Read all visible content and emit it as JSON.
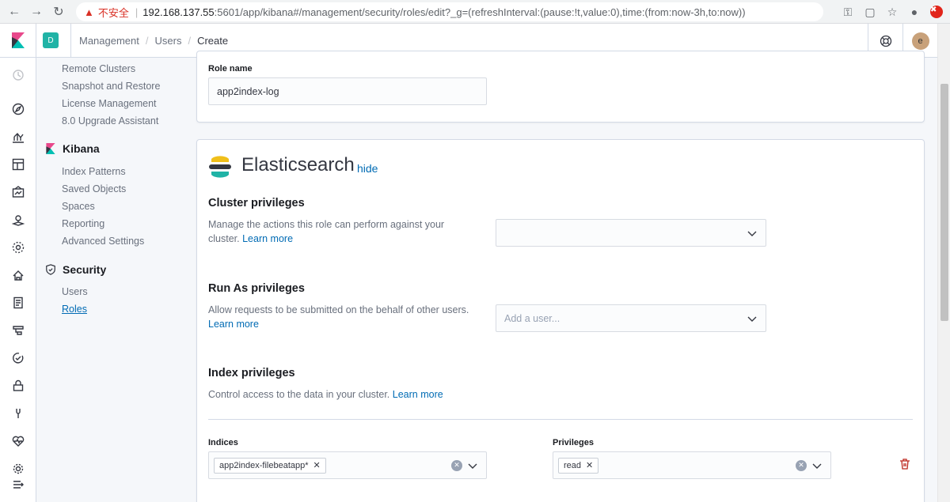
{
  "browser": {
    "insecure_label": "不安全",
    "url_host": "192.168.137.55",
    "url_path": ":5601/app/kibana#/management/security/roles/edit?_g=(refreshInterval:(pause:!t,value:0),time:(from:now-3h,to:now))"
  },
  "header": {
    "space_initial": "D",
    "breadcrumbs": [
      "Management",
      "Users",
      "Create"
    ],
    "avatar_initial": "e"
  },
  "sidebar": {
    "elasticsearch_links": [
      "Remote Clusters",
      "Snapshot and Restore",
      "License Management",
      "8.0 Upgrade Assistant"
    ],
    "kibana_title": "Kibana",
    "kibana_links": [
      "Index Patterns",
      "Saved Objects",
      "Spaces",
      "Reporting",
      "Advanced Settings"
    ],
    "security_title": "Security",
    "security_links": [
      "Users",
      "Roles"
    ]
  },
  "role": {
    "name_label": "Role name",
    "name_value": "app2index-log"
  },
  "elasticsearch": {
    "title": "Elasticsearch",
    "hide_link": "hide",
    "cluster": {
      "title": "Cluster privileges",
      "desc": "Manage the actions this role can perform against your cluster.",
      "learn_more": "Learn more",
      "value": ""
    },
    "run_as": {
      "title": "Run As privileges",
      "desc": "Allow requests to be submitted on the behalf of other users.",
      "learn_more": "Learn more",
      "placeholder": "Add a user..."
    },
    "index": {
      "title": "Index privileges",
      "desc": "Control access to the data in your cluster.",
      "learn_more": "Learn more",
      "indices_label": "Indices",
      "indices_value": "app2index-filebeatapp*",
      "privileges_label": "Privileges",
      "privileges_value": "read"
    }
  },
  "colors": {
    "accent": "#006bb4",
    "space": "#20b3a6",
    "danger": "#bd271e"
  }
}
